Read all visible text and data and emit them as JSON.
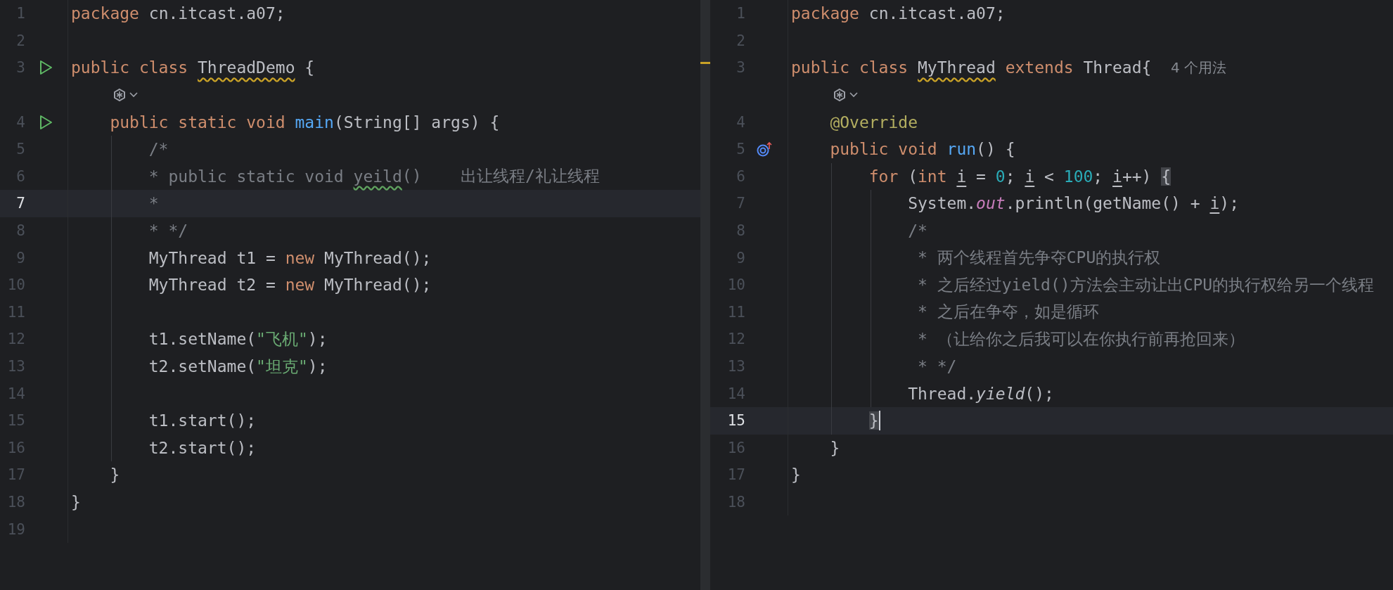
{
  "editors": [
    {
      "focused": false,
      "lines": [
        {
          "kind": "code",
          "number": "1",
          "current": false,
          "tokens": [
            {
              "kind": "kw",
              "text": "package "
            },
            {
              "kind": "plain",
              "text": "cn.itcast.a07;"
            }
          ]
        },
        {
          "kind": "code",
          "number": "2",
          "current": false
        },
        {
          "kind": "code",
          "number": "3",
          "current": false,
          "gutter": {
            "kind": "run"
          },
          "tokens": [
            {
              "kind": "kw",
              "text": "public class "
            },
            {
              "kind": "warn",
              "text": "ThreadDemo"
            },
            {
              "kind": "plain",
              "text": " {"
            }
          ],
          "children": [
            {
              "kind": "inlay"
            },
            {
              "kind": "code",
              "number": "4",
              "current": false,
              "gutter": {
                "kind": "run"
              },
              "tokens": [
                {
                  "kind": "kw",
                  "text": "public static void "
                },
                {
                  "kind": "fn",
                  "text": "main"
                },
                {
                  "kind": "plain",
                  "text": "(String[] args) {"
                }
              ],
              "children": [
                {
                  "kind": "code",
                  "number": "5",
                  "current": false,
                  "tokens": [
                    {
                      "kind": "cmt",
                      "text": "/*"
                    }
                  ]
                },
                {
                  "kind": "code",
                  "number": "6",
                  "current": false,
                  "tokens": [
                    {
                      "kind": "cmt",
                      "text": "* public static void "
                    },
                    {
                      "kind": "typo",
                      "text": "yeild"
                    },
                    {
                      "kind": "cmt",
                      "text": "()    出让线程/礼让线程"
                    }
                  ]
                },
                {
                  "kind": "code",
                  "number": "7",
                  "current": true,
                  "tokens": [
                    {
                      "kind": "cmt",
                      "text": "*"
                    }
                  ]
                },
                {
                  "kind": "code",
                  "number": "8",
                  "current": false,
                  "tokens": [
                    {
                      "kind": "cmt",
                      "text": "* */"
                    }
                  ]
                },
                {
                  "kind": "code",
                  "number": "9",
                  "current": false,
                  "tokens": [
                    {
                      "kind": "plain",
                      "text": "MyThread t1 = "
                    },
                    {
                      "kind": "kw",
                      "text": "new"
                    },
                    {
                      "kind": "plain",
                      "text": " MyThread();"
                    }
                  ]
                },
                {
                  "kind": "code",
                  "number": "10",
                  "current": false,
                  "tokens": [
                    {
                      "kind": "plain",
                      "text": "MyThread t2 = "
                    },
                    {
                      "kind": "kw",
                      "text": "new"
                    },
                    {
                      "kind": "plain",
                      "text": " MyThread();"
                    }
                  ]
                },
                {
                  "kind": "code",
                  "number": "11",
                  "current": false
                },
                {
                  "kind": "code",
                  "number": "12",
                  "current": false,
                  "tokens": [
                    {
                      "kind": "plain",
                      "text": "t1.setName("
                    },
                    {
                      "kind": "str",
                      "text": "\"飞机\""
                    },
                    {
                      "kind": "plain",
                      "text": ");"
                    }
                  ]
                },
                {
                  "kind": "code",
                  "number": "13",
                  "current": false,
                  "tokens": [
                    {
                      "kind": "plain",
                      "text": "t2.setName("
                    },
                    {
                      "kind": "str",
                      "text": "\"坦克\""
                    },
                    {
                      "kind": "plain",
                      "text": ");"
                    }
                  ]
                },
                {
                  "kind": "code",
                  "number": "14",
                  "current": false
                },
                {
                  "kind": "code",
                  "number": "15",
                  "current": false,
                  "tokens": [
                    {
                      "kind": "plain",
                      "text": "t1.start();"
                    }
                  ]
                },
                {
                  "kind": "code",
                  "number": "16",
                  "current": false,
                  "tokens": [
                    {
                      "kind": "plain",
                      "text": "t2.start();"
                    }
                  ]
                }
              ]
            },
            {
              "kind": "code",
              "number": "17",
              "current": false,
              "tokens": [
                {
                  "kind": "plain",
                  "text": "}"
                }
              ]
            }
          ]
        },
        {
          "kind": "code",
          "number": "18",
          "current": false,
          "tokens": [
            {
              "kind": "plain",
              "text": "}"
            }
          ]
        },
        {
          "kind": "code",
          "number": "19",
          "current": false
        }
      ]
    },
    {
      "focused": true,
      "lines": [
        {
          "kind": "code",
          "number": "1",
          "current": false,
          "tokens": [
            {
              "kind": "kw",
              "text": "package "
            },
            {
              "kind": "plain",
              "text": "cn.itcast.a07;"
            }
          ]
        },
        {
          "kind": "code",
          "number": "2",
          "current": false
        },
        {
          "kind": "code",
          "number": "3",
          "current": false,
          "tokens": [
            {
              "kind": "kw",
              "text": "public class "
            },
            {
              "kind": "warn",
              "text": "MyThread"
            },
            {
              "kind": "kw",
              "text": " extends "
            },
            {
              "kind": "plain",
              "text": "Thread{  "
            },
            {
              "kind": "hint",
              "text": "4 个用法"
            }
          ],
          "children": [
            {
              "kind": "inlay"
            },
            {
              "kind": "code",
              "number": "4",
              "current": false,
              "tokens": [
                {
                  "kind": "ann",
                  "text": "@Override"
                }
              ]
            },
            {
              "kind": "code",
              "number": "5",
              "current": false,
              "gutter": {
                "kind": "override"
              },
              "tokens": [
                {
                  "kind": "kw",
                  "text": "public void "
                },
                {
                  "kind": "fn",
                  "text": "run"
                },
                {
                  "kind": "plain",
                  "text": "() {"
                }
              ],
              "children": [
                {
                  "kind": "code",
                  "number": "6",
                  "current": false,
                  "tokens": [
                    {
                      "kind": "kw",
                      "text": "for"
                    },
                    {
                      "kind": "plain",
                      "text": " ("
                    },
                    {
                      "kind": "kw",
                      "text": "int "
                    },
                    {
                      "kind": "var",
                      "text": "i"
                    },
                    {
                      "kind": "plain",
                      "text": " = "
                    },
                    {
                      "kind": "num",
                      "text": "0"
                    },
                    {
                      "kind": "plain",
                      "text": "; "
                    },
                    {
                      "kind": "var",
                      "text": "i"
                    },
                    {
                      "kind": "plain",
                      "text": " < "
                    },
                    {
                      "kind": "num",
                      "text": "100"
                    },
                    {
                      "kind": "plain",
                      "text": "; "
                    },
                    {
                      "kind": "var",
                      "text": "i"
                    },
                    {
                      "kind": "plain",
                      "text": "++) "
                    },
                    {
                      "kind": "brace",
                      "text": "{"
                    }
                  ],
                  "children": [
                    {
                      "kind": "code",
                      "number": "7",
                      "current": false,
                      "tokens": [
                        {
                          "kind": "plain",
                          "text": "System."
                        },
                        {
                          "kind": "field",
                          "text": "out"
                        },
                        {
                          "kind": "plain",
                          "text": ".println(getName() + "
                        },
                        {
                          "kind": "var",
                          "text": "i"
                        },
                        {
                          "kind": "plain",
                          "text": ");"
                        }
                      ]
                    },
                    {
                      "kind": "code",
                      "number": "8",
                      "current": false,
                      "tokens": [
                        {
                          "kind": "cmt",
                          "text": "/*"
                        }
                      ]
                    },
                    {
                      "kind": "code",
                      "number": "9",
                      "current": false,
                      "tokens": [
                        {
                          "kind": "cmt",
                          "text": " * 两个线程首先争夺CPU的执行权"
                        }
                      ]
                    },
                    {
                      "kind": "code",
                      "number": "10",
                      "current": false,
                      "tokens": [
                        {
                          "kind": "cmt",
                          "text": " * 之后经过yield()方法会主动让出CPU的执行权给另一个线程"
                        }
                      ]
                    },
                    {
                      "kind": "code",
                      "number": "11",
                      "current": false,
                      "tokens": [
                        {
                          "kind": "cmt",
                          "text": " * 之后在争夺，如是循环"
                        }
                      ]
                    },
                    {
                      "kind": "code",
                      "number": "12",
                      "current": false,
                      "tokens": [
                        {
                          "kind": "cmt",
                          "text": " * （让给你之后我可以在你执行前再抢回来）"
                        }
                      ]
                    },
                    {
                      "kind": "code",
                      "number": "13",
                      "current": false,
                      "tokens": [
                        {
                          "kind": "cmt",
                          "text": " * */"
                        }
                      ]
                    },
                    {
                      "kind": "code",
                      "number": "14",
                      "current": false,
                      "tokens": [
                        {
                          "kind": "plain",
                          "text": "Thread."
                        },
                        {
                          "kind": "static",
                          "text": "yield"
                        },
                        {
                          "kind": "plain",
                          "text": "();"
                        }
                      ]
                    }
                  ]
                },
                {
                  "kind": "code",
                  "number": "15",
                  "current": true,
                  "tokens": [
                    {
                      "kind": "brace",
                      "text": "}"
                    }
                  ]
                }
              ]
            },
            {
              "kind": "code",
              "number": "16",
              "current": false,
              "tokens": [
                {
                  "kind": "plain",
                  "text": "}"
                }
              ]
            }
          ]
        },
        {
          "kind": "code",
          "number": "17",
          "current": false,
          "tokens": [
            {
              "kind": "plain",
              "text": "}"
            }
          ]
        },
        {
          "kind": "code",
          "number": "18",
          "current": false
        }
      ]
    }
  ]
}
